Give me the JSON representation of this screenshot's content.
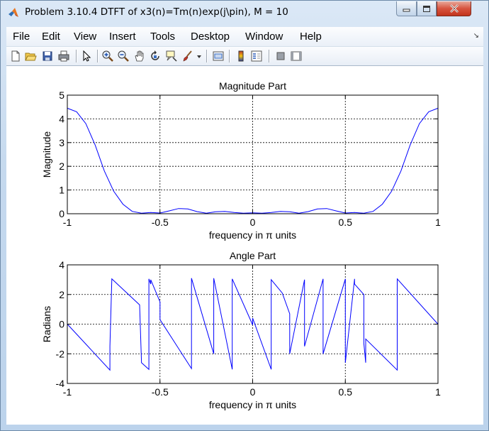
{
  "window": {
    "title": "Problem 3.10.4 DTFT of x3(n)=Tm(n)exp(j\\pin), M = 10"
  },
  "menu": [
    "File",
    "Edit",
    "View",
    "Insert",
    "Tools",
    "Desktop",
    "Window",
    "Help"
  ],
  "toolbar": {
    "icons": [
      "new-figure-icon",
      "open-file-icon",
      "save-icon",
      "print-icon",
      "pointer-icon",
      "zoom-in-icon",
      "zoom-out-icon",
      "pan-hand-icon",
      "rotate-3d-icon",
      "data-cursor-icon",
      "brush-icon",
      "brush-dropdown-icon",
      "link-plot-icon",
      "colorbar-icon",
      "legend-icon",
      "hide-plot-tools-icon",
      "show-plot-tools-icon"
    ]
  },
  "colors": {
    "line": "#0000ff",
    "axis": "#000000",
    "grid": "#000000"
  },
  "chart_data": [
    {
      "type": "line",
      "title": "Magnitude Part",
      "xlabel": "frequency in π units",
      "ylabel": "Magnitude",
      "xlim": [
        -1,
        1
      ],
      "ylim": [
        0,
        5
      ],
      "xticks": [
        "-1",
        "-0.5",
        "0",
        "0.5",
        "1"
      ],
      "yticks": [
        "0",
        "1",
        "2",
        "3",
        "4",
        "5"
      ],
      "grid": true,
      "series": [
        {
          "x": [
            -1,
            -0.95,
            -0.9,
            -0.85,
            -0.8,
            -0.75,
            -0.7,
            -0.65,
            -0.6,
            -0.55,
            -0.5,
            -0.45,
            -0.4,
            -0.35,
            -0.3,
            -0.25,
            -0.2,
            -0.15,
            -0.1,
            -0.05,
            0,
            0.05,
            0.1,
            0.15,
            0.2,
            0.25,
            0.3,
            0.35,
            0.4,
            0.45,
            0.5,
            0.55,
            0.6,
            0.65,
            0.7,
            0.75,
            0.8,
            0.85,
            0.9,
            0.95,
            1
          ],
          "y": [
            4.45,
            4.3,
            3.8,
            2.9,
            1.8,
            0.95,
            0.4,
            0.1,
            0.02,
            0.05,
            0.03,
            0.12,
            0.22,
            0.2,
            0.09,
            0.02,
            0.08,
            0.1,
            0.05,
            0.02,
            0.04,
            0.02,
            0.05,
            0.1,
            0.08,
            0.02,
            0.09,
            0.2,
            0.22,
            0.12,
            0.03,
            0.05,
            0.02,
            0.1,
            0.4,
            0.95,
            1.8,
            2.9,
            3.8,
            4.3,
            4.45
          ]
        }
      ]
    },
    {
      "type": "line",
      "title": "Angle Part",
      "xlabel": "frequency in π units",
      "ylabel": "Radians",
      "xlim": [
        -1,
        1
      ],
      "ylim": [
        -4,
        4
      ],
      "xticks": [
        "-1",
        "-0.5",
        "0",
        "0.5",
        "1"
      ],
      "yticks": [
        "-4",
        "-2",
        "0",
        "2",
        "4"
      ],
      "grid": true,
      "series": [
        {
          "x": [
            -1,
            -0.77,
            -0.77,
            -0.76,
            -0.61,
            -0.6,
            -0.6,
            -0.56,
            -0.56,
            -0.55,
            -0.55,
            -0.5,
            -0.5,
            -0.33,
            -0.33,
            -0.21,
            -0.21,
            -0.11,
            -0.11,
            0.0,
            0.0,
            0.1,
            0.1,
            0.16,
            0.2,
            0.2,
            0.28,
            0.28,
            0.38,
            0.38,
            0.5,
            0.5,
            0.55,
            0.55,
            0.6,
            0.6,
            0.61,
            0.61,
            0.78,
            0.78,
            1
          ],
          "y": [
            0,
            -3.1,
            -1.5,
            3.05,
            1.3,
            -2.5,
            -2.6,
            -3.05,
            3.05,
            2.7,
            3.0,
            1.5,
            0.3,
            -3.0,
            3.1,
            -2.0,
            3.1,
            -3.05,
            3.05,
            -0.05,
            0.4,
            -3.05,
            3.0,
            2.1,
            0.7,
            -2.0,
            3.0,
            -1.5,
            3.05,
            -2.0,
            3.05,
            -2.6,
            3.05,
            2.7,
            2.0,
            -1.3,
            -2.6,
            -1.0,
            -3.1,
            3.05,
            0
          ]
        }
      ]
    }
  ]
}
